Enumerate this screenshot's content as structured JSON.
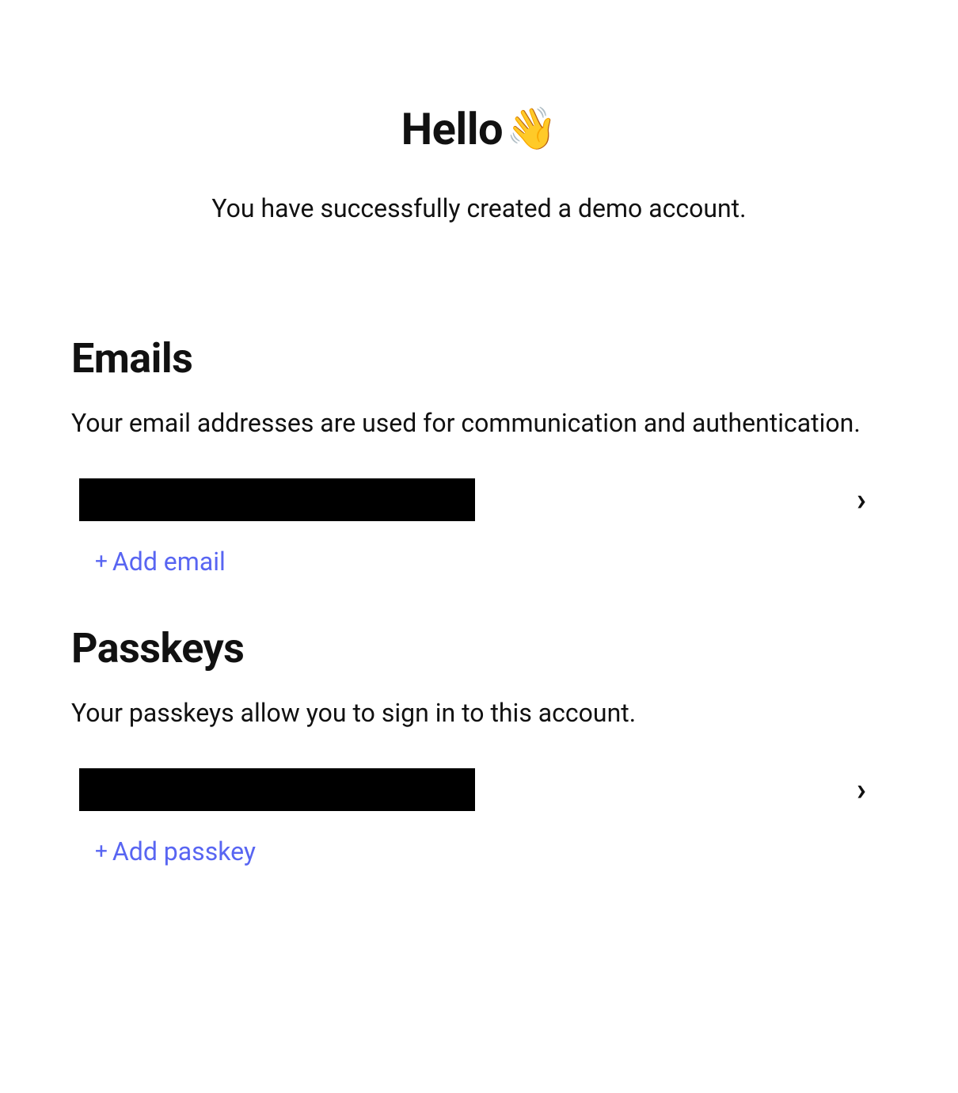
{
  "hero": {
    "title": "Hello",
    "wave": "👋",
    "subtitle": "You have successfully created a demo account."
  },
  "emails": {
    "title": "Emails",
    "description": "Your email addresses are used for communication and authentication.",
    "items": [
      {
        "value": "[redacted]"
      }
    ],
    "add_label": "Add email"
  },
  "passkeys": {
    "title": "Passkeys",
    "description": "Your passkeys allow you to sign in to this account.",
    "items": [
      {
        "value": "[redacted]"
      }
    ],
    "add_label": "Add passkey"
  },
  "colors": {
    "link": "#5865f2"
  }
}
